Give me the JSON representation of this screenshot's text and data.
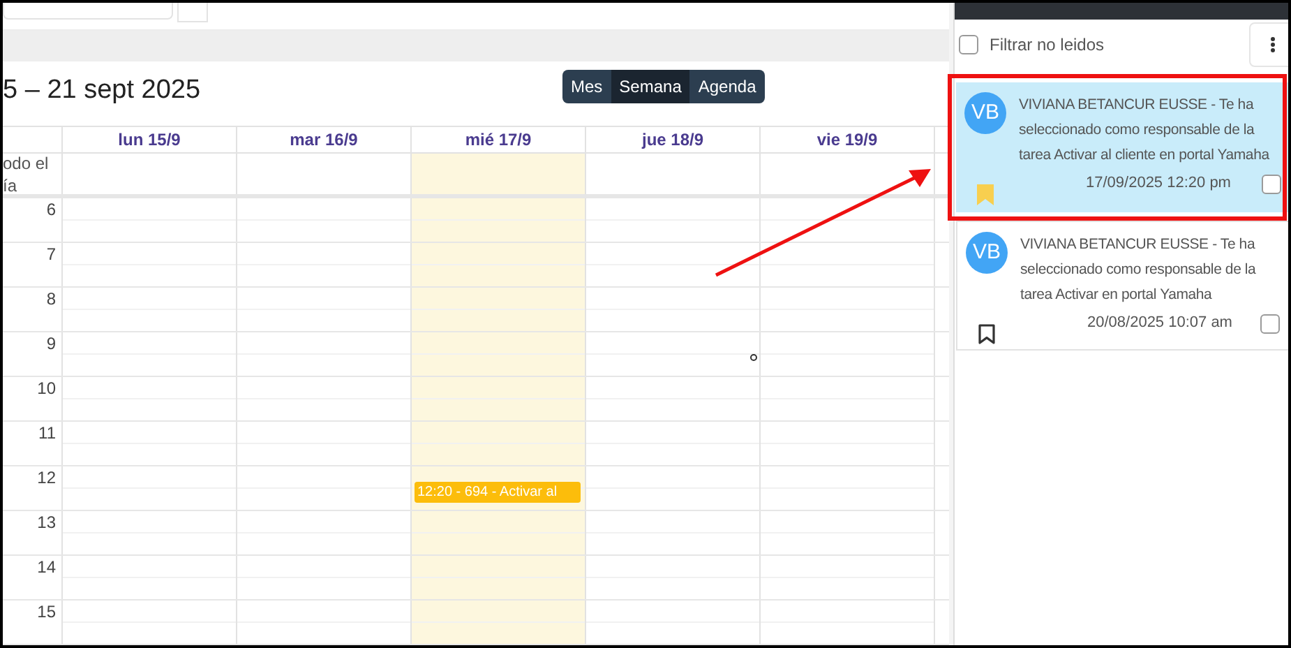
{
  "calendar": {
    "title": "5 – 21 sept 2025",
    "views": [
      {
        "label": "Mes",
        "selected": false
      },
      {
        "label": "Semana",
        "selected": true
      },
      {
        "label": "Agenda",
        "selected": false
      }
    ],
    "all_day_label": [
      "odo el",
      "ía"
    ],
    "days": [
      {
        "label": "lun 15/9",
        "today": false
      },
      {
        "label": "mar 16/9",
        "today": false
      },
      {
        "label": "mié 17/9",
        "today": true
      },
      {
        "label": "jue 18/9",
        "today": false
      },
      {
        "label": "vie 19/9",
        "today": false
      }
    ],
    "hours": [
      {
        "label": "6"
      },
      {
        "label": "7"
      },
      {
        "label": "8"
      },
      {
        "label": "9"
      },
      {
        "label": "10"
      },
      {
        "label": "11"
      },
      {
        "label": "12",
        "today_events": [
          {
            "label": "12:20 - 694 - Activar al"
          }
        ]
      },
      {
        "label": "13"
      },
      {
        "label": "14"
      },
      {
        "label": "15"
      }
    ]
  },
  "notifications": {
    "filter": {
      "label": "Filtrar no leidos",
      "checked": false
    },
    "items": [
      {
        "avatar": "VB",
        "text": "VIVIANA BETANCUR EUSSE - Te ha seleccionado como responsable de la tarea Activar al cliente en portal Yamaha",
        "time": "17/09/2025 12:20 pm",
        "selected": true,
        "bookmarked": true,
        "checked": false
      },
      {
        "avatar": "VB",
        "text": "VIVIANA BETANCUR EUSSE - Te ha seleccionado como responsable de la tarea Activar en portal Yamaha",
        "time": "20/08/2025 10:07 am",
        "selected": false,
        "bookmarked": false,
        "checked": false
      }
    ]
  }
}
